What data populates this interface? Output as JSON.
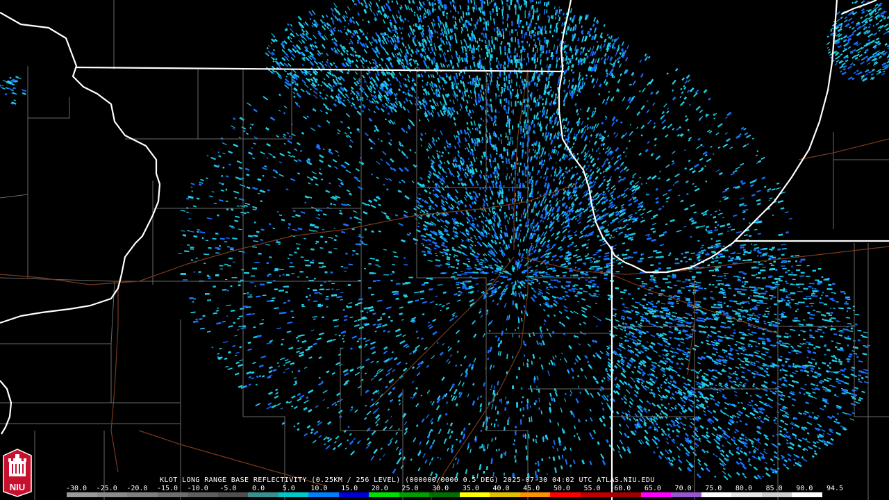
{
  "product": {
    "line": "KLOT LONG RANGE BASE REFLECTIVITY (0.25KM / 256 LEVEL) (000000/0000 0.5 DEG) 2025-07-30 04:02 UTC  ATLAS.NIU.EDU"
  },
  "legend": {
    "labels": [
      "-30.0",
      "-25.0",
      "-20.0",
      "-15.0",
      "-10.0",
      "-5.0",
      "0.0",
      "5.0",
      "10.0",
      "15.0",
      "20.0",
      "25.0",
      "30.0",
      "35.0",
      "40.0",
      "45.0",
      "50.0",
      "55.0",
      "60.0",
      "65.0",
      "70.0",
      "75.0",
      "80.0",
      "85.0",
      "90.0",
      "94.5"
    ],
    "colors": [
      "#9a9a9a",
      "#8c8c8c",
      "#7f7f7f",
      "#6f6f6f",
      "#5f5f5f",
      "#4f4f4f",
      "#3a8f8f",
      "#00c8c8",
      "#0080ff",
      "#0000d8",
      "#00e000",
      "#00a000",
      "#007000",
      "#ffff00",
      "#e0c000",
      "#ff9000",
      "#ff0000",
      "#c00000",
      "#a00000",
      "#ff00ff",
      "#9a55d0",
      "#ffffff",
      "#e8e8e8",
      "#d0d0d0",
      "#ffffff"
    ]
  },
  "logo": {
    "text": "NIU",
    "bg_color": "#c8102e"
  },
  "colors": {
    "state_borders": "#ffffff",
    "county_borders": "#6a6a6a",
    "roads": "#7a3a1a",
    "echo_main": "#1ec8e0",
    "echo_light": "#22d6ee",
    "echo_deep": "#1870ff"
  }
}
